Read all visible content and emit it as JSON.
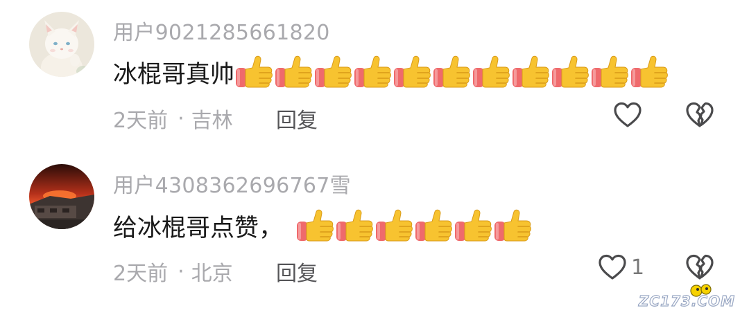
{
  "comments": [
    {
      "username": "用户9021285661820",
      "text": "冰棍哥真帅",
      "thumbs": 11,
      "time": "2天前",
      "location": "吉林",
      "reply_label": "回复",
      "like_count": ""
    },
    {
      "username": "用户4308362696767雪",
      "text": "给冰棍哥点赞，",
      "thumbs": 6,
      "time": "2天前",
      "location": "北京",
      "reply_label": "回复",
      "like_count": "1"
    }
  ],
  "separator": "·",
  "icons": {
    "like": "heart-outline-icon",
    "dislike": "broken-heart-outline-icon",
    "emoji": "thumbs-up-emoji"
  },
  "colors": {
    "username": "#a9a9ad",
    "text": "#1a1a1a",
    "meta": "#a9a9ad",
    "reply": "#555558",
    "thumb_yellow": "#f7c330",
    "thumb_sleeve": "#ef6a6c"
  },
  "watermark": "ZC173.COM"
}
